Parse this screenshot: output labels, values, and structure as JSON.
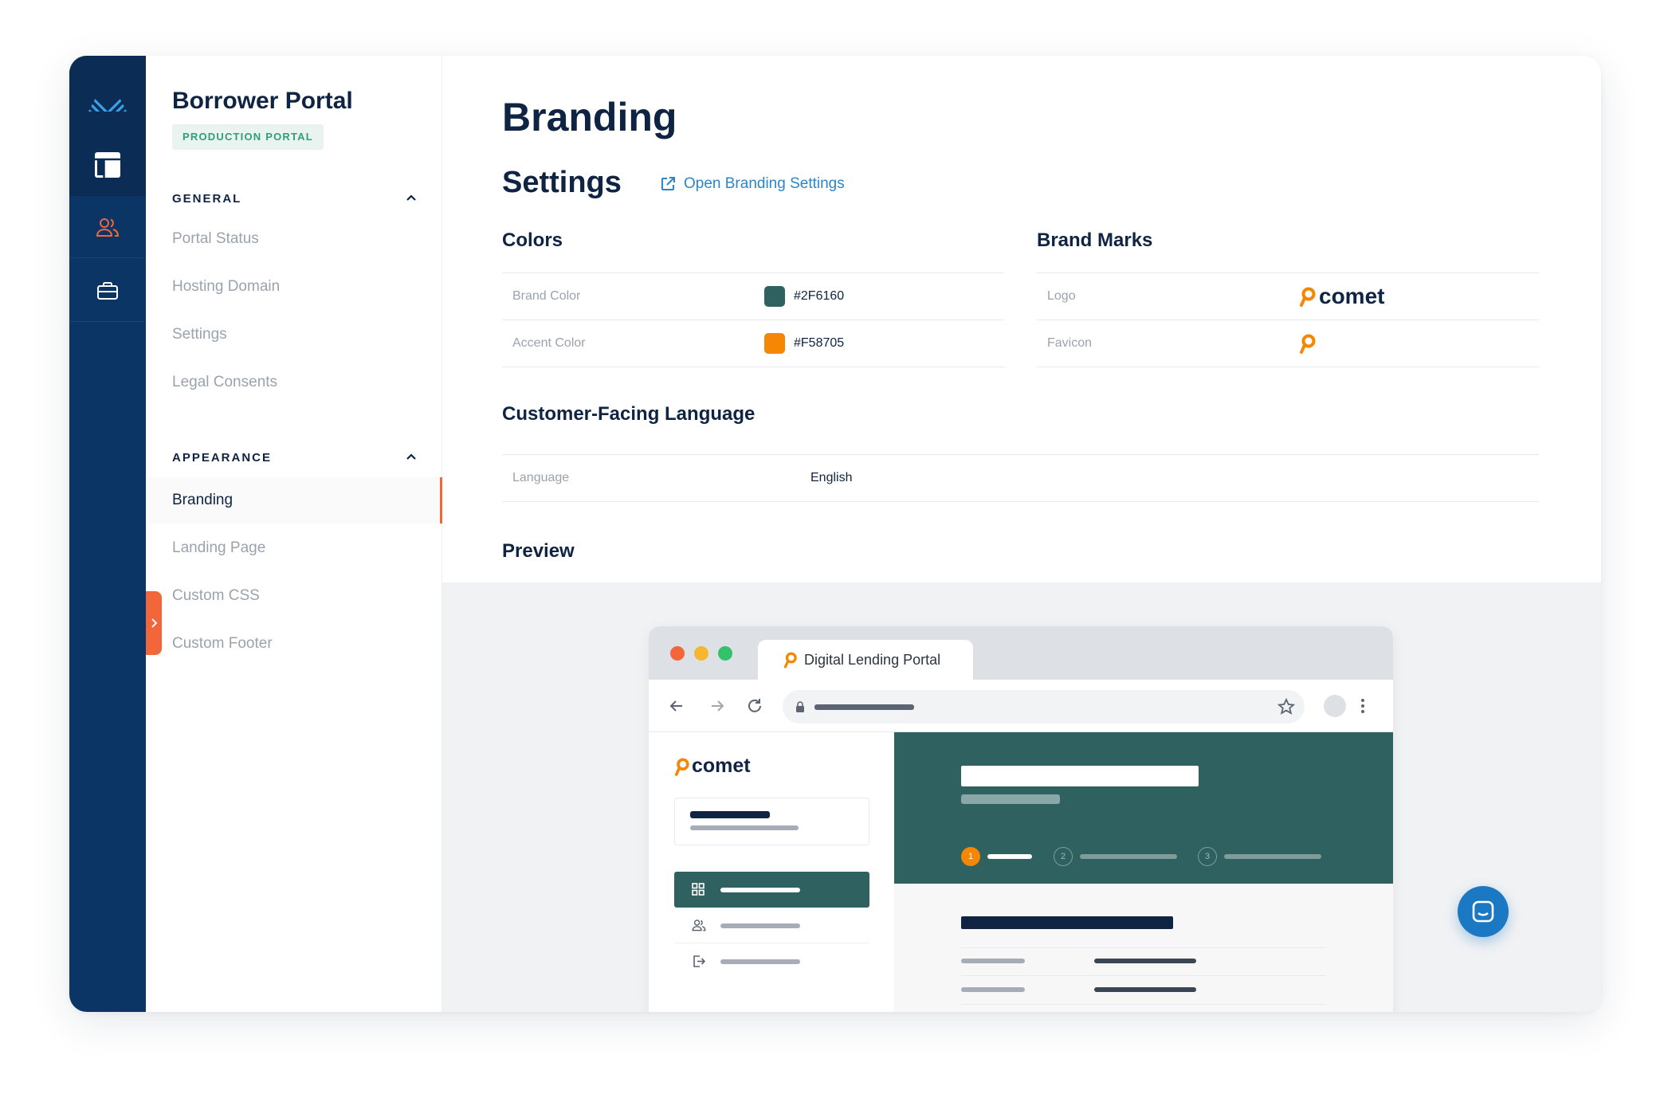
{
  "sidebar": {
    "title": "Borrower Portal",
    "badge": "PRODUCTION PORTAL",
    "sections": [
      {
        "heading": "GENERAL",
        "items": [
          "Portal Status",
          "Hosting Domain",
          "Settings",
          "Legal Consents"
        ]
      },
      {
        "heading": "APPEARANCE",
        "items": [
          "Branding",
          "Landing Page",
          "Custom CSS",
          "Custom Footer"
        ]
      }
    ],
    "active_item": "Branding"
  },
  "main": {
    "title": "Branding",
    "settings_heading": "Settings",
    "open_link": "Open Branding Settings",
    "colors": {
      "heading": "Colors",
      "rows": [
        {
          "label": "Brand Color",
          "value": "#2F6160",
          "swatch": "#2f6160"
        },
        {
          "label": "Accent Color",
          "value": "#F58705",
          "swatch": "#f58705"
        }
      ]
    },
    "brand_marks": {
      "heading": "Brand Marks",
      "rows": [
        {
          "label": "Logo",
          "value": "comet"
        },
        {
          "label": "Favicon"
        }
      ]
    },
    "language": {
      "heading": "Customer-Facing Language",
      "label": "Language",
      "value": "English"
    },
    "preview_heading": "Preview"
  },
  "preview": {
    "tab_title": "Digital Lending Portal",
    "logo_text": "comet",
    "steps": [
      "1",
      "2",
      "3"
    ]
  },
  "colors": {
    "navy": "#0b3564",
    "brand": "#2f6160",
    "accent": "#f58705",
    "active_marker": "#f2663a",
    "link": "#2a86c9"
  },
  "icons": [
    "logo-icon",
    "layout-icon",
    "users-icon",
    "briefcase-icon",
    "chevron-up-icon",
    "chevron-right-icon",
    "external-link-icon",
    "comet-mark-icon",
    "chat-icon"
  ]
}
